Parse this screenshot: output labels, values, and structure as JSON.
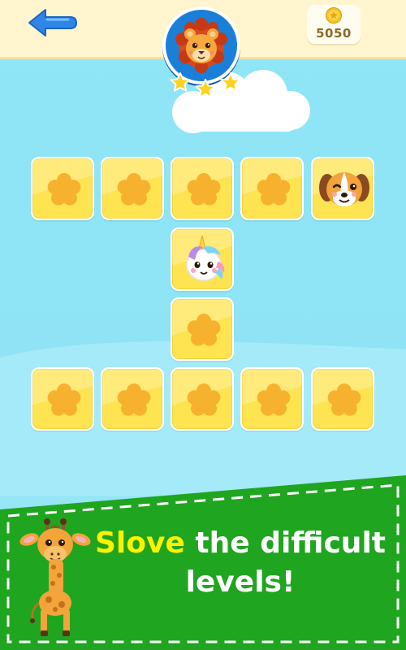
{
  "header": {
    "coins": "5050",
    "back_icon": "back-arrow-icon",
    "coin_icon": "coin-icon",
    "avatar": "lion-avatar",
    "stars_earned": 3,
    "stars_total": 3
  },
  "board": {
    "tile_color": "#ffe451",
    "flower_color": "#f6b22e",
    "rows": [
      [
        "hidden",
        "hidden",
        "hidden",
        "hidden",
        "dog"
      ],
      [
        null,
        null,
        "unicorn",
        null,
        null
      ],
      [
        null,
        null,
        "hidden",
        null,
        null
      ],
      [
        "hidden",
        "hidden",
        "hidden",
        "hidden",
        "hidden"
      ]
    ]
  },
  "banner": {
    "highlight": "Slove",
    "line1_rest": " the difficult",
    "line2": "levels!",
    "highlight_color": "#fff200",
    "background_color": "#1fa51f",
    "mascot": "giraffe"
  }
}
